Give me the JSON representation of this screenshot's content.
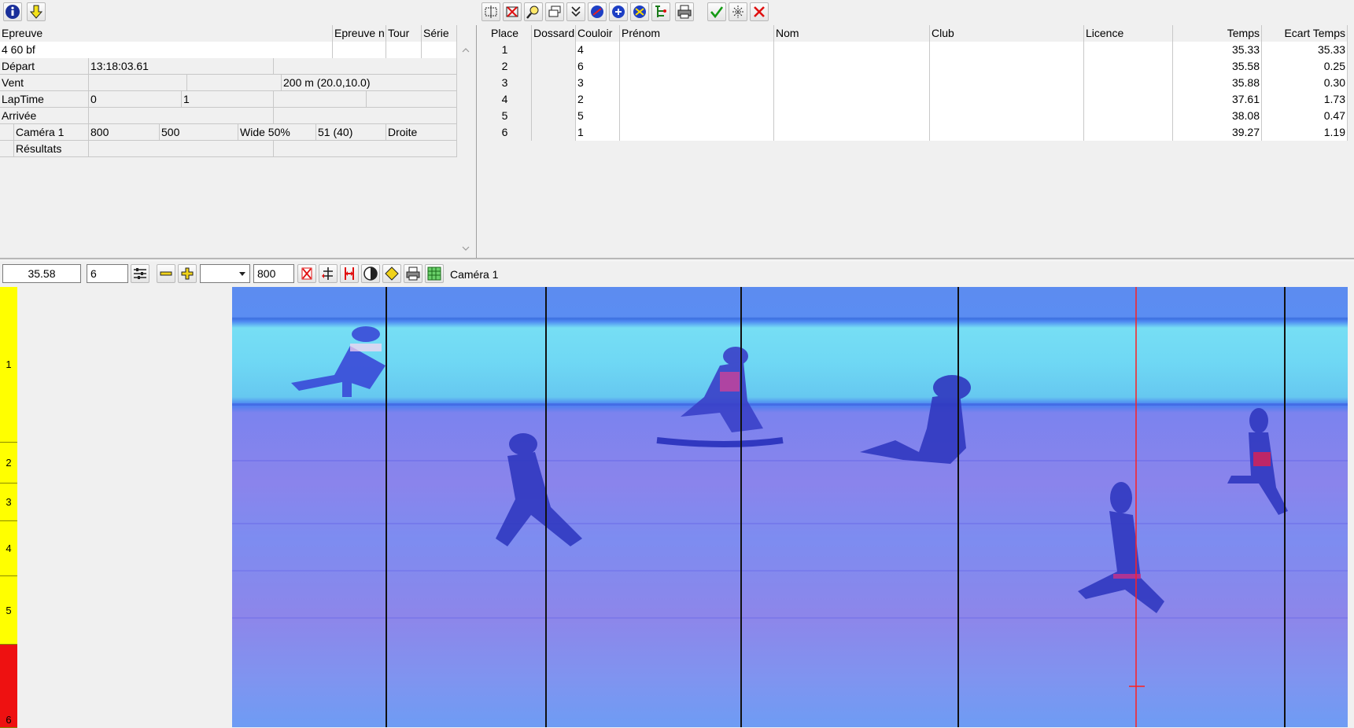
{
  "app": {
    "left_toolbar_icons": [
      "info-icon",
      "download-arrow-icon"
    ],
    "right_toolbar_icons": [
      "select-frame-icon",
      "delete-icon",
      "zoom-icon",
      "windows-icon",
      "check-list-icon",
      "runner-blue-icon",
      "runner-add-icon",
      "runner-remove-icon",
      "tree-icon",
      "print-icon",
      "checkmark-icon",
      "split-icon",
      "cancel-icon"
    ]
  },
  "event_grid": {
    "headers": [
      "Epreuve",
      "Epreuve n",
      "Tour",
      "Série"
    ],
    "event_name": "4 60 bf",
    "rows": [
      {
        "label": "Départ",
        "c1": "13:18:03.61",
        "c2": ""
      },
      {
        "label": "Vent",
        "c1": "",
        "c2": "",
        "c3": "200 m (20.0,10.0)"
      },
      {
        "label": "LapTime",
        "c1": "0",
        "c2": "1"
      },
      {
        "label": "Arrivée",
        "c1": "",
        "c2": ""
      }
    ],
    "camera": {
      "label": "Caméra 1",
      "v1": "800",
      "v2": "500",
      "v3": "Wide 50%",
      "v4": "51  (40)",
      "v5": "Droite"
    },
    "results_label": "Résultats"
  },
  "results_table": {
    "headers": {
      "place": "Place",
      "dossard": "Dossard",
      "couloir": "Couloir",
      "prenom": "Prénom",
      "nom": "Nom",
      "club": "Club",
      "licence": "Licence",
      "temps": "Temps",
      "ecart": "Ecart Temps"
    },
    "rows": [
      {
        "place": "1",
        "dossard": "",
        "couloir": "4",
        "prenom": "",
        "nom": "",
        "club": "",
        "licence": "",
        "temps": "35.33",
        "ecart": "35.33"
      },
      {
        "place": "2",
        "dossard": "",
        "couloir": "6",
        "prenom": "",
        "nom": "",
        "club": "",
        "licence": "",
        "temps": "35.58",
        "ecart": "0.25"
      },
      {
        "place": "3",
        "dossard": "",
        "couloir": "3",
        "prenom": "",
        "nom": "",
        "club": "",
        "licence": "",
        "temps": "35.88",
        "ecart": "0.30"
      },
      {
        "place": "4",
        "dossard": "",
        "couloir": "2",
        "prenom": "",
        "nom": "",
        "club": "",
        "licence": "",
        "temps": "37.61",
        "ecart": "1.73"
      },
      {
        "place": "5",
        "dossard": "",
        "couloir": "5",
        "prenom": "",
        "nom": "",
        "club": "",
        "licence": "",
        "temps": "38.08",
        "ecart": "0.47"
      },
      {
        "place": "6",
        "dossard": "",
        "couloir": "1",
        "prenom": "",
        "nom": "",
        "club": "",
        "licence": "",
        "temps": "39.27",
        "ecart": "1.19"
      }
    ]
  },
  "photo_toolbar": {
    "time_value": "35.58",
    "lane_value": "6",
    "dropdown_value": "",
    "width_value": "800",
    "camera_label": "Caméra 1"
  },
  "lanes": [
    {
      "label": "1",
      "color": "#ffff00"
    },
    {
      "label": "2",
      "color": "#ffff00"
    },
    {
      "label": "3",
      "color": "#ffff00"
    },
    {
      "label": "4",
      "color": "#ffff00"
    },
    {
      "label": "5",
      "color": "#ffff00"
    },
    {
      "label": "6",
      "color": "#ee1111"
    }
  ],
  "colors": {
    "cursor_line": "#ff2020",
    "lane_yellow": "#ffff00",
    "lane_red": "#ee1111"
  }
}
